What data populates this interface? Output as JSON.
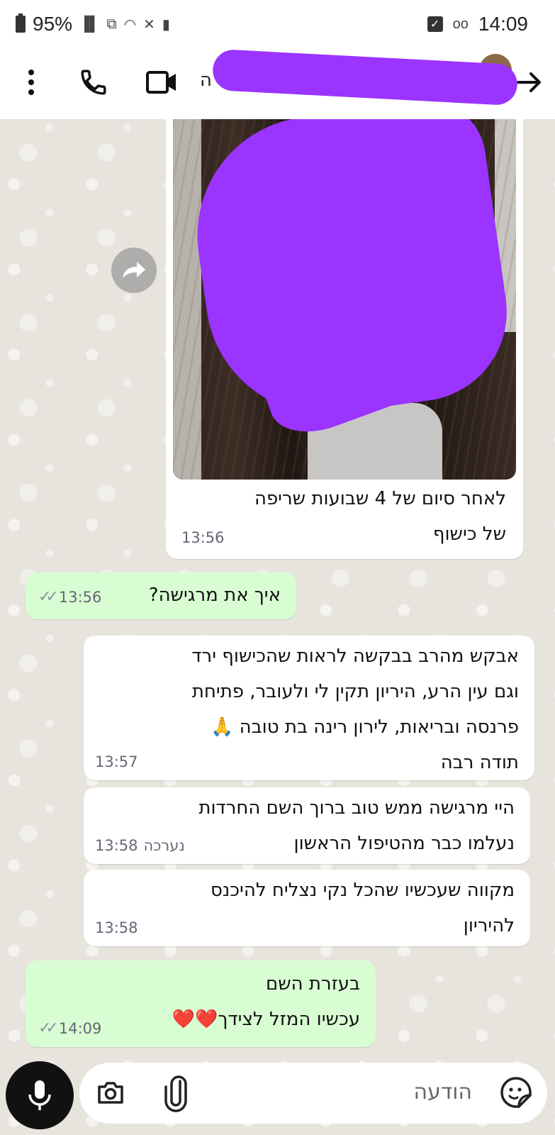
{
  "status_bar": {
    "battery": "95%",
    "time": "14:09"
  },
  "header": {
    "contact_name": "ה"
  },
  "messages": [
    {
      "type": "incoming-image",
      "caption_line1": "לאחר סיום של 4 שבועות שריפה",
      "caption_line2": "של כישוף",
      "time": "13:56"
    },
    {
      "type": "outgoing",
      "text": "איך את מרגישה?",
      "time": "13:56"
    },
    {
      "type": "incoming",
      "line1": "אבקש מהרב בבקשה לראות שהכישוף ירד",
      "line2": "וגם עין הרע, היריון תקין לי ולעובר, פתיחת",
      "line3": "פרנסה ובריאות, לירון רינה בת טובה 🙏",
      "line4": "תודה רבה",
      "time": "13:57"
    },
    {
      "type": "incoming",
      "line1": "היי מרגישה ממש טוב ברוך השם החרדות",
      "line2": "נעלמו כבר מהטיפול הראשון",
      "edited": "נערכה",
      "time": "13:58"
    },
    {
      "type": "incoming",
      "line1": "מקווה שעכשיו שהכל נקי נצליח להיכנס",
      "line2": "להיריון",
      "time": "13:58"
    },
    {
      "type": "outgoing",
      "line1": "בעזרת השם",
      "line2": "עכשיו המזל לצידך❤️❤️",
      "time": "14:09"
    }
  ],
  "input": {
    "placeholder": "הודעה"
  },
  "colors": {
    "incoming_bubble": "#ffffff",
    "outgoing_bubble": "#d9fdd3",
    "redaction": "#9b34ff"
  }
}
